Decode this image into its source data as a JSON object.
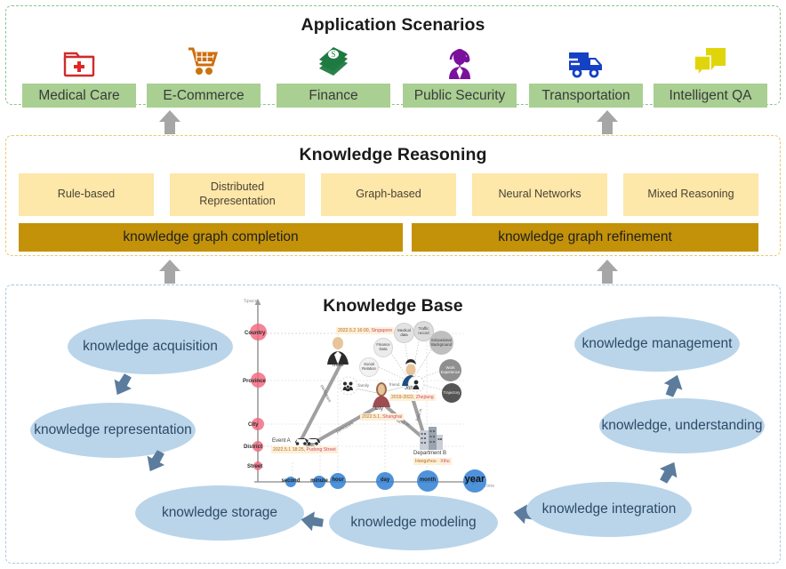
{
  "layers": {
    "application": {
      "title": "Application Scenarios",
      "items": [
        {
          "label": "Medical Care",
          "icon": "medical-folder-icon"
        },
        {
          "label": "E-Commerce",
          "icon": "shopping-cart-icon"
        },
        {
          "label": "Finance",
          "icon": "money-stack-icon"
        },
        {
          "label": "Public Security",
          "icon": "security-agent-icon"
        },
        {
          "label": "Transportation",
          "icon": "delivery-truck-icon"
        },
        {
          "label": "Intelligent QA",
          "icon": "chat-bubbles-icon"
        }
      ]
    },
    "reasoning": {
      "title": "Knowledge Reasoning",
      "methods": [
        {
          "label": "Rule-based"
        },
        {
          "label": "Distributed Representation"
        },
        {
          "label": "Graph-based"
        },
        {
          "label": "Neural Networks"
        },
        {
          "label": "Mixed Reasoning"
        }
      ],
      "tasks": [
        {
          "label": "knowledge graph completion"
        },
        {
          "label": "knowledge graph refinement"
        }
      ]
    },
    "base": {
      "title": "Knowledge Base",
      "stages": [
        {
          "label": "knowledge acquisition"
        },
        {
          "label": "knowledge representation"
        },
        {
          "label": "knowledge storage"
        },
        {
          "label": "knowledge modeling"
        },
        {
          "label": "knowledge integration"
        },
        {
          "label": "knowledge, understanding"
        },
        {
          "label": "knowledge management"
        }
      ]
    }
  },
  "illustration": {
    "space_axis": {
      "name": "Space",
      "levels": [
        "Country",
        "Province",
        "City",
        "District",
        "Street"
      ]
    },
    "time_axis": {
      "name": "Time",
      "levels": [
        "second",
        "minute",
        "hour",
        "day",
        "month",
        "year"
      ]
    },
    "entities": [
      {
        "name": "Mike",
        "tag_time": "2022.5.2 16:00,",
        "tag_place": "Singapore"
      },
      {
        "name": "Lily",
        "tag_time": "2022.5.1,",
        "tag_place": "Shanghai"
      },
      {
        "name": "John",
        "tag_time": "2019-2022,",
        "tag_place": "Zhejiang"
      },
      {
        "name": "Event A",
        "tag_time": "2022.5.1 18:25,",
        "tag_place": "Pudong Street"
      },
      {
        "name": "Department B",
        "tag_time": "Hangzhou ·",
        "tag_place": "Xihu"
      }
    ],
    "attributes": [
      "Social Relation",
      "Finance Data",
      "Medical data",
      "Traffic record",
      "Educational Background",
      "Work Experience",
      "Trajectory"
    ],
    "edges": [
      "participant",
      "participant",
      "family",
      "friend",
      "work in",
      "lived in"
    ]
  },
  "colors": {
    "app_panel_border": "#8cc28c",
    "app_chip": "#a9cf92",
    "reason_panel_border": "#e8c86a",
    "reason_chip": "#fde7a9",
    "reason_bar": "#c39209",
    "base_panel_border": "#a8c6e0",
    "base_ellipse": "#bad5ea",
    "arrow_gray": "#a6a6a6",
    "arrow_blue": "#5b7c9d"
  }
}
